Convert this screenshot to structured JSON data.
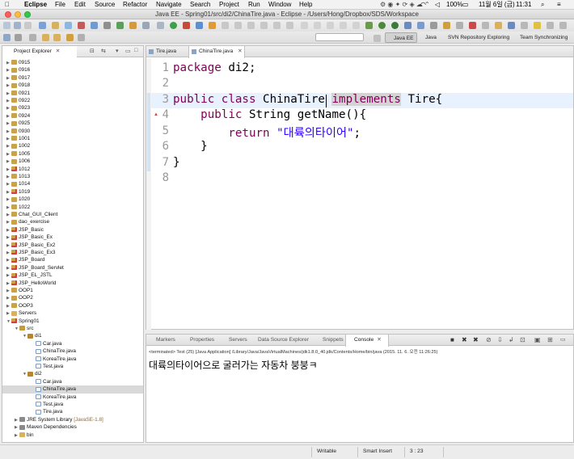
{
  "menubar": {
    "app": "Eclipse",
    "items": [
      "File",
      "Edit",
      "Source",
      "Refactor",
      "Navigate",
      "Search",
      "Project",
      "Run",
      "Window",
      "Help"
    ],
    "status_right": {
      "battery": "100%",
      "date": "11월 6일 (금)",
      "time": "11:31"
    }
  },
  "window": {
    "title": "Java EE - Spring01/src/di2/ChinaTire.java - Eclipse - /Users/Hong/Dropbox/SDS/Workspace"
  },
  "perspectives": [
    "Java EE",
    "Java",
    "SVN Repository Exploring",
    "Team Synchronizing"
  ],
  "project_explorer": {
    "tab_label": "Project Explorer",
    "items": [
      {
        "label": "0915",
        "depth": 0,
        "kind": "project"
      },
      {
        "label": "0916",
        "depth": 0,
        "kind": "project"
      },
      {
        "label": "0917",
        "depth": 0,
        "kind": "project"
      },
      {
        "label": "0918",
        "depth": 0,
        "kind": "project"
      },
      {
        "label": "0921",
        "depth": 0,
        "kind": "project"
      },
      {
        "label": "0922",
        "depth": 0,
        "kind": "project"
      },
      {
        "label": "0923",
        "depth": 0,
        "kind": "project"
      },
      {
        "label": "0924",
        "depth": 0,
        "kind": "project"
      },
      {
        "label": "0925",
        "depth": 0,
        "kind": "project"
      },
      {
        "label": "0930",
        "depth": 0,
        "kind": "project"
      },
      {
        "label": "1001",
        "depth": 0,
        "kind": "project"
      },
      {
        "label": "1002",
        "depth": 0,
        "kind": "project"
      },
      {
        "label": "1005",
        "depth": 0,
        "kind": "project"
      },
      {
        "label": "1006",
        "depth": 0,
        "kind": "project"
      },
      {
        "label": "1012",
        "depth": 0,
        "kind": "project-err"
      },
      {
        "label": "1013",
        "depth": 0,
        "kind": "project"
      },
      {
        "label": "1014",
        "depth": 0,
        "kind": "project"
      },
      {
        "label": "1019",
        "depth": 0,
        "kind": "project-err"
      },
      {
        "label": "1020",
        "depth": 0,
        "kind": "project"
      },
      {
        "label": "1022",
        "depth": 0,
        "kind": "project"
      },
      {
        "label": "Chat_GUI_Client",
        "depth": 0,
        "kind": "project"
      },
      {
        "label": "dao_exercise",
        "depth": 0,
        "kind": "project"
      },
      {
        "label": "JSP_Basic",
        "depth": 0,
        "kind": "project-err"
      },
      {
        "label": "JSP_Basic_Ex",
        "depth": 0,
        "kind": "project-err"
      },
      {
        "label": "JSP_Basic_Ex2",
        "depth": 0,
        "kind": "project-err"
      },
      {
        "label": "JSP_Basic_Ex3",
        "depth": 0,
        "kind": "project-err"
      },
      {
        "label": "JSP_Board",
        "depth": 0,
        "kind": "project-err"
      },
      {
        "label": "JSP_Board_Servlet",
        "depth": 0,
        "kind": "project-err"
      },
      {
        "label": "JSP_EL_JSTL",
        "depth": 0,
        "kind": "project-err"
      },
      {
        "label": "JSP_HelloWorld",
        "depth": 0,
        "kind": "project-err"
      },
      {
        "label": "OOP1",
        "depth": 0,
        "kind": "project"
      },
      {
        "label": "OOP2",
        "depth": 0,
        "kind": "project"
      },
      {
        "label": "OOP3",
        "depth": 0,
        "kind": "project"
      },
      {
        "label": "Servers",
        "depth": 0,
        "kind": "folder"
      },
      {
        "label": "Spring01",
        "depth": 0,
        "kind": "project-err",
        "open": true
      },
      {
        "label": "src",
        "depth": 1,
        "kind": "src",
        "open": true
      },
      {
        "label": "di1",
        "depth": 2,
        "kind": "package",
        "open": true
      },
      {
        "label": "Car.java",
        "depth": 3,
        "kind": "java"
      },
      {
        "label": "ChinaTire.java",
        "depth": 3,
        "kind": "java"
      },
      {
        "label": "KoreaTire.java",
        "depth": 3,
        "kind": "java"
      },
      {
        "label": "Test.java",
        "depth": 3,
        "kind": "java"
      },
      {
        "label": "di2",
        "depth": 2,
        "kind": "package",
        "open": true
      },
      {
        "label": "Car.java",
        "depth": 3,
        "kind": "java"
      },
      {
        "label": "ChinaTire.java",
        "depth": 3,
        "kind": "java",
        "selected": true
      },
      {
        "label": "KoreaTire.java",
        "depth": 3,
        "kind": "java"
      },
      {
        "label": "Test.java",
        "depth": 3,
        "kind": "java"
      },
      {
        "label": "Tire.java",
        "depth": 3,
        "kind": "java"
      },
      {
        "label": "JRE System Library",
        "suffix": "[JavaSE-1.8]",
        "depth": 1,
        "kind": "lib"
      },
      {
        "label": "Maven Dependencies",
        "depth": 1,
        "kind": "lib"
      },
      {
        "label": "bin",
        "depth": 1,
        "kind": "folder"
      }
    ]
  },
  "editor": {
    "tabs": [
      {
        "label": "Tire.java",
        "active": false
      },
      {
        "label": "ChinaTire.java",
        "active": true
      }
    ],
    "line_numbers": [
      "1",
      "2",
      "3",
      "4",
      "5",
      "6",
      "7",
      "8"
    ],
    "code": {
      "l1_kw": "package",
      "l1_rest": " di2;",
      "l3_kw1": "public",
      "l3_kw2": "class",
      "l3_name": " ChinaTire",
      "l3_kw3": "implements",
      "l3_rest": " Tire{",
      "l4_kw": "public",
      "l4_rest": " String getName(){",
      "l5_kw": "return",
      "l5_str": "\"대륙의타이어\"",
      "l5_rest": ";",
      "l6": "}",
      "l7": "}"
    }
  },
  "console": {
    "tabs": [
      "Markers",
      "Properties",
      "Servers",
      "Data Source Explorer",
      "Snippets",
      "Console"
    ],
    "active_tab": "Console",
    "header": "<terminated> Test (25) [Java Application] /Library/Java/JavaVirtualMachines/jdk1.8.0_40.jdk/Contents/Home/bin/java (2015. 11. 6. 오전 11:26:25)",
    "output": "대륙의타이어으로 굴러가는 자동차 붕붕ㅋ"
  },
  "statusbar": {
    "mode": "Writable",
    "insert": "Smart Insert",
    "position": "3 : 23"
  }
}
